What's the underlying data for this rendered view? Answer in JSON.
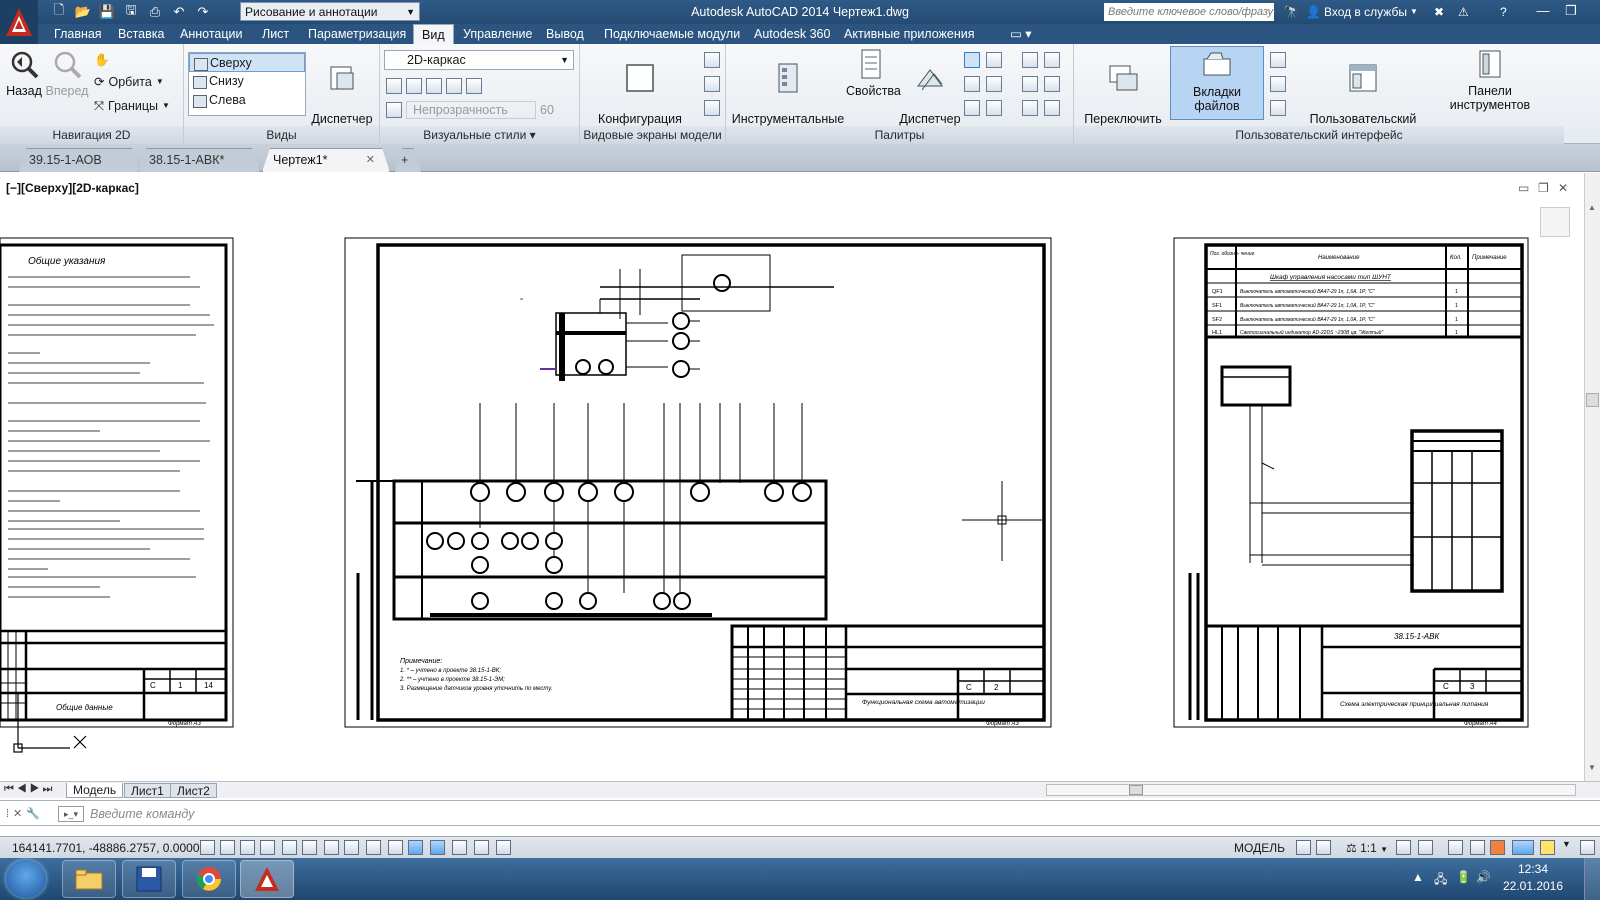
{
  "window": {
    "title": "Autodesk AutoCAD 2014     Чертеж1.dwg",
    "workspace": "Рисование и аннотации",
    "search_placeholder": "Введите ключевое слово/фразу",
    "signin": "Вход в службы"
  },
  "ribbon_tabs": [
    "Главная",
    "Вставка",
    "Аннотации",
    "Лист",
    "Параметризация",
    "Вид",
    "Управление",
    "Вывод",
    "Подключаемые модули",
    "Autodesk 360",
    "Активные приложения"
  ],
  "ribbon_active_tab": "Вид",
  "ribbon": {
    "nav2d": {
      "title": "Навигация 2D",
      "back": "Назад",
      "forward": "Вперед",
      "orbit": "Орбита",
      "bounds": "Границы"
    },
    "views": {
      "title": "Виды",
      "items": [
        "Сверху",
        "Снизу",
        "Слева"
      ],
      "manager": "Диспетчер\nвидов"
    },
    "visual_styles": {
      "title": "Визуальные стили",
      "style": "2D-каркас",
      "opacity_label": "Непрозрачность",
      "opacity_value": "60"
    },
    "model_viewports": {
      "title": "Видовые экраны модели",
      "config": "Конфигурация\nвидового экрана"
    },
    "palettes": {
      "title": "Палитры",
      "tool_palettes": "Инструментальные\nпалитры",
      "properties": "Свойства",
      "sheet_manager": "Диспетчер\nподшивок"
    },
    "ui": {
      "title": "Пользовательский интерфейс",
      "switch_windows": "Переключить\nокна",
      "file_tabs": "Вкладки файлов",
      "custom_ui": "Пользовательский\nинтерфейс",
      "toolbars": "Панели инструментов"
    }
  },
  "file_tabs": [
    {
      "label": "39.15-1-АОВ",
      "active": false
    },
    {
      "label": "38.15-1-АВК*",
      "active": false
    },
    {
      "label": "Чертеж1*",
      "active": true
    }
  ],
  "viewport_label": "[−][Сверху][2D-каркас]",
  "drawing": {
    "sheet1": {
      "heading": "Общие указания",
      "stamp_name": "Общие данные",
      "sheet_letter": "С",
      "sheet_no": "1",
      "sheets": "14",
      "format": "Формат А3"
    },
    "sheet2": {
      "stamp_name": "Функциональная схема\nавтоматизации",
      "sheet_letter": "С",
      "sheet_no": "2",
      "format": "Формат А3",
      "notes": [
        "Примечание:",
        "1. * – учтено в проекте 38.15-1-ВК;",
        "2. ** – учтено в проекте 38.15-1-ЭМ;",
        "3. Размещение датчиков уровня уточнить по месту."
      ]
    },
    "sheet3": {
      "code": "38.15-1-АВК",
      "stamp_name": "Схема электрическая\nпринципиальная питания",
      "sheet_letter": "С",
      "sheet_no": "3",
      "format": "Формат А4",
      "table_headers": [
        "Поз. обозна- чение",
        "Наименование",
        "Кол.",
        "Примечание"
      ],
      "table_title": "Шкаф управления насосами тип ШУНТ",
      "rows": [
        {
          "pos": "QF1",
          "name": "Выключатель автоматический ВА47-29 1п, 1,6А, 1P, \"С\"",
          "qty": "1"
        },
        {
          "pos": "SF1",
          "name": "Выключатель автоматический ВА47-29 1п, 1,0А, 1P, \"С\"",
          "qty": "1"
        },
        {
          "pos": "SF2",
          "name": "Выключатель автоматический ВА47-29 1п, 1,0А, 1P, \"С\"",
          "qty": "1"
        },
        {
          "pos": "HL1",
          "name": "Светосигнальный индикатор AD-22DS ~230В цв. \"Желтый\"",
          "qty": "1"
        }
      ]
    }
  },
  "layout_tabs": [
    "Модель",
    "Лист1",
    "Лист2"
  ],
  "command_placeholder": "Введите команду",
  "status": {
    "coords": "164141.7701, -48886.2757, 0.0000",
    "space": "МОДЕЛЬ",
    "scale": "1:1"
  },
  "taskbar": {
    "time": "12:34",
    "date": "22.01.2016"
  },
  "colors": {
    "title_bar": "#2b5580",
    "ribbon_bg": "#eef1f4",
    "active_tab": "#f3f5f8",
    "highlight": "#cfe3f7"
  }
}
